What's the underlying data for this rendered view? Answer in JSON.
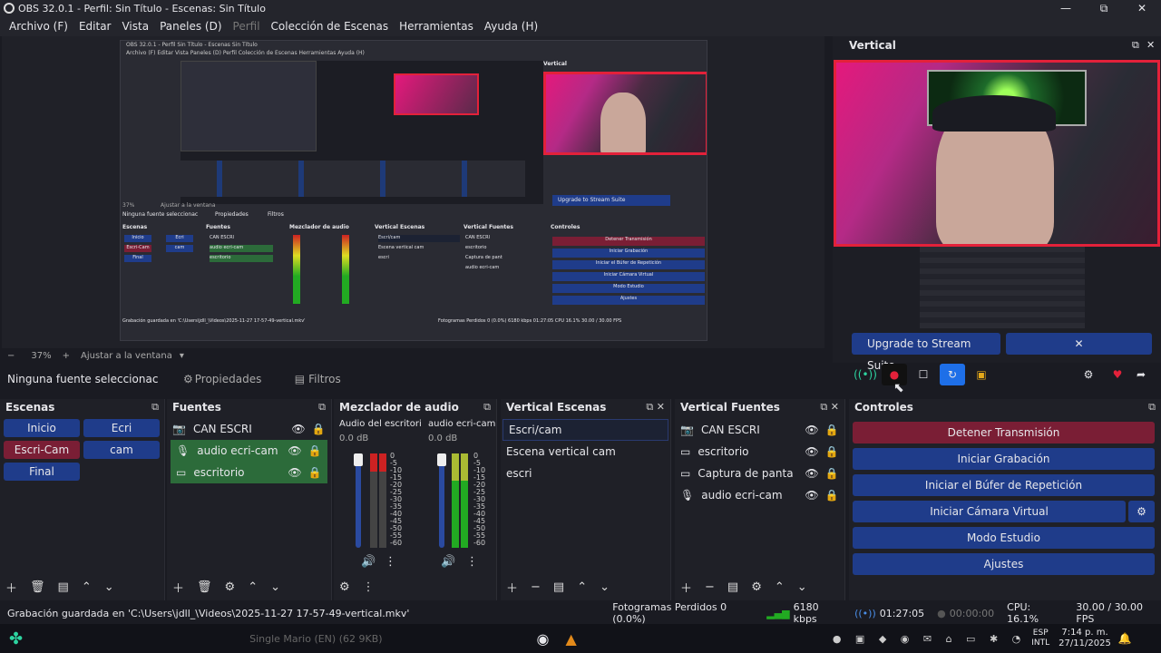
{
  "window": {
    "title": "OBS 32.0.1 - Perfil: Sin Título - Escenas: Sin Título",
    "minimize": "—",
    "maximize": "⧉",
    "close": "✕"
  },
  "menu": [
    "Archivo (F)",
    "Editar",
    "Vista",
    "Paneles (D)",
    "Perfil",
    "Colección de Escenas",
    "Herramientas",
    "Ayuda (H)"
  ],
  "nested": {
    "title": "OBS 32.0.1 - Perfil Sin Título - Escenas Sin Título",
    "menu": "Archivo (F)   Editar   Vista   Paneles (D)   Perfil   Colección de Escenas   Herramientas   Ayuda (H)",
    "vertical_label": "Vertical",
    "upgrade": "Upgrade to Stream Suite",
    "no_source": "Ninguna fuente seleccionac",
    "props": "Propiedades",
    "filters": "Filtros",
    "zoom": "37%",
    "fit": "Ajustar a la ventana",
    "scenes_title": "Escenas",
    "sources_title": "Fuentes",
    "mixer_title": "Mezclador de audio",
    "vscenes_title": "Vertical Escenas",
    "vsources_title": "Vertical Fuentes",
    "controls_title": "Controles",
    "scenes": [
      "Inicio",
      "Ecri",
      "Escri-Cam",
      "cam",
      "Final"
    ],
    "sources": [
      "CAN ESCRI",
      "audio ecri-cam",
      "escritorio"
    ],
    "vscenes": [
      "Escri/cam",
      "Escena vertical cam",
      "escri"
    ],
    "vsources": [
      "CAN ESCRI",
      "escritorio",
      "Captura de pant",
      "audio ecri-cam"
    ],
    "controls": [
      "Detener Transmisión",
      "Iniciar Grabación",
      "Iniciar el Búfer de Repetición",
      "Iniciar Cámara Virtual",
      "Modo Estudio",
      "Ajustes"
    ],
    "status": "Grabación guardada en 'C:\\Users\\jdll_\\Videos\\2025-11-27 17-57-49-vertical.mkv'",
    "stats": "Fotogramas Perdidos 0 (0.0%)   6180 kbps   01:27:05   CPU 16.1%   30.00 / 30.00 FPS"
  },
  "vertical_panel": {
    "title": "Vertical",
    "upgrade_label": "Upgrade to Stream Suite",
    "close_label": "✕"
  },
  "zoom": {
    "value": "37%",
    "minus": "−",
    "plus": "+",
    "fit_label": "Ajustar a la ventana"
  },
  "properties_bar": {
    "no_source": "Ninguna fuente seleccionac",
    "properties": "Propiedades",
    "filters": "Filtros"
  },
  "panels": {
    "scenes": {
      "title": "Escenas",
      "items": [
        "Inicio",
        "Ecri",
        "Escri-Cam",
        "cam",
        "Final"
      ]
    },
    "sources": {
      "title": "Fuentes",
      "items": [
        {
          "name": "CAN ESCRI",
          "icon": "camera-icon"
        },
        {
          "name": "audio ecri-cam",
          "icon": "mic-icon"
        },
        {
          "name": "escritorio",
          "icon": "monitor-icon"
        }
      ]
    },
    "mixer": {
      "title": "Mezclador de audio",
      "channels": [
        {
          "name": "Audio del escritoric",
          "db": "0.0 dB"
        },
        {
          "name": "audio ecri-cam",
          "db": "0.0 dB"
        }
      ],
      "scale": [
        "0",
        "-5",
        "-10",
        "-15",
        "-20",
        "-25",
        "-30",
        "-35",
        "-40",
        "-45",
        "-50",
        "-55",
        "-60"
      ]
    },
    "vscenes": {
      "title": "Vertical Escenas",
      "items": [
        "Escri/cam",
        "Escena vertical cam",
        "escri"
      ]
    },
    "vsources": {
      "title": "Vertical Fuentes",
      "items": [
        {
          "name": "CAN ESCRI",
          "icon": "camera-icon"
        },
        {
          "name": "escritorio",
          "icon": "monitor-icon"
        },
        {
          "name": "Captura de panta",
          "icon": "monitor-icon"
        },
        {
          "name": "audio ecri-cam",
          "icon": "mic-icon"
        }
      ]
    },
    "controls": {
      "title": "Controles",
      "buttons": [
        "Detener Transmisión",
        "Iniciar Grabación",
        "Iniciar el Búfer de Repetición",
        "Iniciar Cámara Virtual",
        "Modo Estudio",
        "Ajustes"
      ]
    }
  },
  "status": {
    "saved": "Grabación guardada en 'C:\\Users\\jdll_\\Videos\\2025-11-27 17-57-49-vertical.mkv'",
    "dropped": "Fotogramas Perdidos 0 (0.0%)",
    "bitrate": "6180 kbps",
    "stream_time": "01:27:05",
    "rec_time": "00:00:00",
    "cpu": "CPU: 16.1%",
    "fps": "30.00 / 30.00 FPS"
  },
  "taskbar": {
    "lang_top": "ESP",
    "lang_bottom": "INTL",
    "time": "7:14 p. m.",
    "date": "27/11/2025",
    "faded_text": "Single Mario (EN) (62 9KB)"
  },
  "colors": {
    "accent": "#1f3c8a",
    "stop": "#7a1e35",
    "active": "#2c6b3a",
    "camera_border": "#e3213a"
  }
}
